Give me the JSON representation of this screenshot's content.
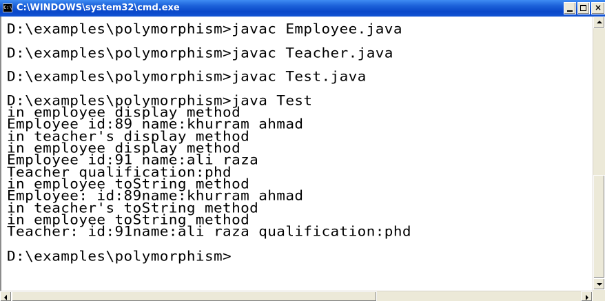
{
  "window": {
    "title": "C:\\WINDOWS\\system32\\cmd.exe",
    "icon": "console-icon",
    "icon_text": "C:\\"
  },
  "console": {
    "lines": [
      "D:\\examples\\polymorphism>javac Employee.java",
      "D:\\examples\\polymorphism>javac Teacher.java",
      "D:\\examples\\polymorphism>javac Test.java",
      "D:\\examples\\polymorphism>java Test",
      "in employee display method",
      "Employee id:89 name:khurram ahmad",
      "in teacher's display method",
      "in employee display method",
      "Employee id:91 name:ali raza",
      "Teacher qualification:phd",
      "in employee toString method",
      "Employee: id:89name:khurram ahmad",
      "in teacher's toString method",
      "in employee toString method",
      "Teacher: id:91name:ali raza qualification:phd",
      "D:\\examples\\polymorphism>"
    ]
  },
  "colors": {
    "titlebar": "#0a48c9",
    "console_bg": "#ffffff",
    "console_text": "#000000"
  }
}
